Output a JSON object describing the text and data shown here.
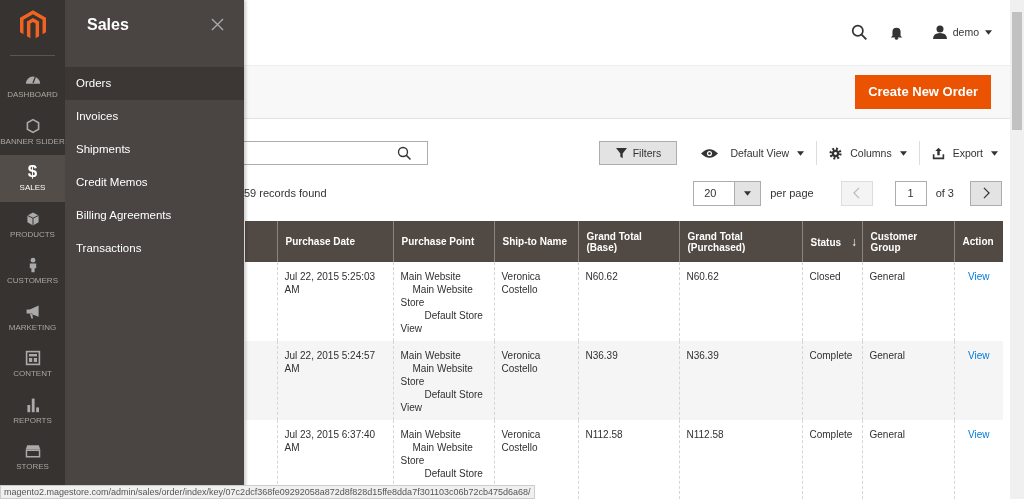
{
  "nav": [
    {
      "label": "DASHBOARD",
      "selected": false
    },
    {
      "label": "BANNER SLIDER",
      "selected": false
    },
    {
      "label": "SALES",
      "glyph": "$",
      "selected": true
    },
    {
      "label": "PRODUCTS",
      "selected": false
    },
    {
      "label": "CUSTOMERS",
      "selected": false
    },
    {
      "label": "MARKETING",
      "selected": false
    },
    {
      "label": "CONTENT",
      "selected": false
    },
    {
      "label": "REPORTS",
      "selected": false
    },
    {
      "label": "STORES",
      "selected": false
    }
  ],
  "flyout": {
    "title": "Sales",
    "items": [
      {
        "label": "Orders",
        "selected": true
      },
      {
        "label": "Invoices",
        "selected": false
      },
      {
        "label": "Shipments",
        "selected": false
      },
      {
        "label": "Credit Memos",
        "selected": false
      },
      {
        "label": "Billing Agreements",
        "selected": false
      },
      {
        "label": "Transactions",
        "selected": false
      }
    ]
  },
  "header": {
    "user": "demo"
  },
  "create_button": "Create New Order",
  "toolbar": {
    "filters": "Filters",
    "view": "Default View",
    "columns": "Columns",
    "export": "Export"
  },
  "records": "59 records found",
  "pager": {
    "per_page_value": "20",
    "per_page_label": "per page",
    "page": "1",
    "of": "of 3",
    "prev_disabled": true
  },
  "table": {
    "columns": [
      {
        "label": "Purchase Date"
      },
      {
        "label": "Purchase Point"
      },
      {
        "label": "Ship-to Name"
      },
      {
        "label": "Grand Total (Base)"
      },
      {
        "label": "Grand Total (Purchased)"
      },
      {
        "label": "Status",
        "sort_arrow": "↓"
      },
      {
        "label": "Customer Group"
      },
      {
        "label": "Action"
      }
    ],
    "rows": [
      {
        "date": "Jul 22, 2015 5:25:03 AM",
        "point": [
          {
            "text": "Main Website",
            "children": [
              {
                "text": "Main Website Store",
                "children": [
                  {
                    "text": "Default Store View"
                  }
                ]
              }
            ]
          }
        ],
        "ship_to": "Veronica Costello",
        "base": "N60.62",
        "purchased": "N60.62",
        "status": "Closed",
        "group": "General",
        "action": "View"
      },
      {
        "date": "Jul 22, 2015 5:24:57 AM",
        "point": [
          {
            "text": "Main Website",
            "children": [
              {
                "text": "Main Website Store",
                "children": [
                  {
                    "text": "Default Store View"
                  }
                ]
              }
            ]
          }
        ],
        "ship_to": "Veronica Costello",
        "base": "N36.39",
        "purchased": "N36.39",
        "status": "Complete",
        "group": "General",
        "action": "View"
      },
      {
        "date": "Jul 23, 2015 6:37:40 AM",
        "point": [
          {
            "text": "Main Website",
            "children": [
              {
                "text": "Main Website Store",
                "children": [
                  {
                    "text": "Default Store"
                  }
                ]
              }
            ]
          }
        ],
        "ship_to": "Veronica Costello",
        "base": "N112.58",
        "purchased": "N112.58",
        "status": "Complete",
        "group": "General",
        "action": "View"
      }
    ]
  },
  "status_url": "magento2.magestore.com/admin/sales/order/index/key/07c2dcf368fe09292058a872d8f828d15ffe8dda7f301103c06b72cb475d6a68/"
}
